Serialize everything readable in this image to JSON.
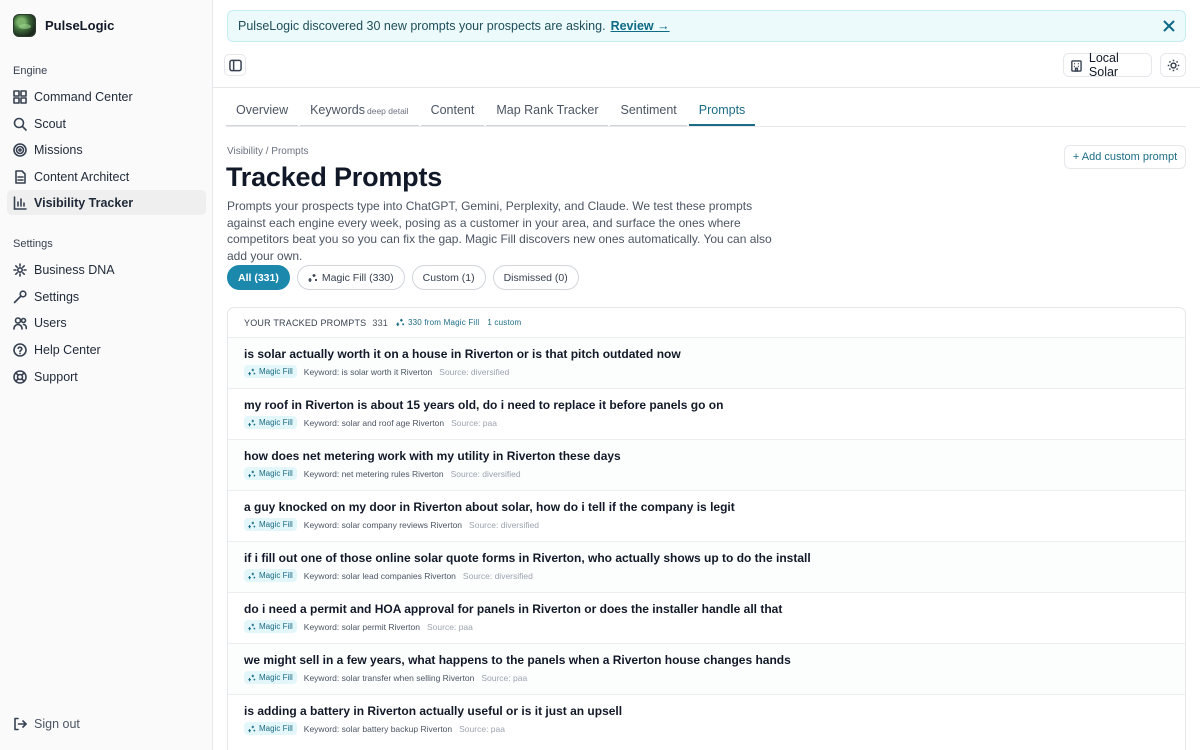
{
  "brand": {
    "name": "PulseLogic"
  },
  "sidebar": {
    "engine_label": "Engine",
    "settings_label": "Settings",
    "engine_items": [
      {
        "label": "Command Center",
        "icon": "grid-icon"
      },
      {
        "label": "Scout",
        "icon": "search-icon"
      },
      {
        "label": "Missions",
        "icon": "target-icon"
      },
      {
        "label": "Content Architect",
        "icon": "document-icon"
      },
      {
        "label": "Visibility Tracker",
        "icon": "bar-chart-icon",
        "active": true
      }
    ],
    "settings_items": [
      {
        "label": "Business DNA",
        "icon": "gear-icon"
      },
      {
        "label": "Settings",
        "icon": "wrench-icon"
      },
      {
        "label": "Users",
        "icon": "users-icon"
      },
      {
        "label": "Help Center",
        "icon": "help-icon"
      },
      {
        "label": "Support",
        "icon": "lifebuoy-icon"
      }
    ],
    "signout_label": "Sign out"
  },
  "banner": {
    "text": "PulseLogic discovered 30 new prompts your prospects are asking.",
    "link": "Review →"
  },
  "header": {
    "location_label": "Local Solar"
  },
  "tabs": [
    {
      "label": "Overview",
      "sub": ""
    },
    {
      "label": "Keywords",
      "sub": "deep detail"
    },
    {
      "label": "Content",
      "sub": ""
    },
    {
      "label": "Map Rank Tracker",
      "sub": ""
    },
    {
      "label": "Sentiment",
      "sub": ""
    },
    {
      "label": "Prompts",
      "sub": "",
      "active": true
    }
  ],
  "page": {
    "breadcrumb": "Visibility / Prompts",
    "title": "Tracked Prompts",
    "add_button": "+ Add custom prompt",
    "description": "Prompts your prospects type into ChatGPT, Gemini, Perplexity, and Claude. We test these prompts against each engine every week, posing as a customer in your area, and surface the ones where competitors beat you so you can fix the gap. Magic Fill discovers new ones automatically. You can also add your own."
  },
  "filters": [
    {
      "label": "All (331)",
      "active": true
    },
    {
      "label": "Magic Fill (330)",
      "icon": true
    },
    {
      "label": "Custom (1)"
    },
    {
      "label": "Dismissed (0)"
    }
  ],
  "list": {
    "heading": "YOUR TRACKED PROMPTS",
    "count": "331",
    "magic_fill_count": "330 from Magic Fill",
    "custom_count": "1 custom",
    "badge_label": "Magic Fill",
    "rows": [
      {
        "title": "is solar actually worth it on a house in Riverton or is that pitch outdated now",
        "keyword": "Keyword: is solar worth it Riverton",
        "source": "Source: diversified"
      },
      {
        "title": "my roof in Riverton is about 15 years old, do i need to replace it before panels go on",
        "keyword": "Keyword: solar and roof age Riverton",
        "source": "Source: paa"
      },
      {
        "title": "how does net metering work with my utility in Riverton these days",
        "keyword": "Keyword: net metering rules Riverton",
        "source": "Source: diversified"
      },
      {
        "title": "a guy knocked on my door in Riverton about solar, how do i tell if the company is legit",
        "keyword": "Keyword: solar company reviews Riverton",
        "source": "Source: diversified"
      },
      {
        "title": "if i fill out one of those online solar quote forms in Riverton, who actually shows up to do the install",
        "keyword": "Keyword: solar lead companies Riverton",
        "source": "Source: diversified"
      },
      {
        "title": "do i need a permit and HOA approval for panels in Riverton or does the installer handle all that",
        "keyword": "Keyword: solar permit Riverton",
        "source": "Source: paa"
      },
      {
        "title": "we might sell in a few years, what happens to the panels when a Riverton house changes hands",
        "keyword": "Keyword: solar transfer when selling Riverton",
        "source": "Source: paa"
      },
      {
        "title": "is adding a battery in Riverton actually useful or is it just an upsell",
        "keyword": "Keyword: solar battery backup Riverton",
        "source": "Source: paa"
      }
    ]
  }
}
